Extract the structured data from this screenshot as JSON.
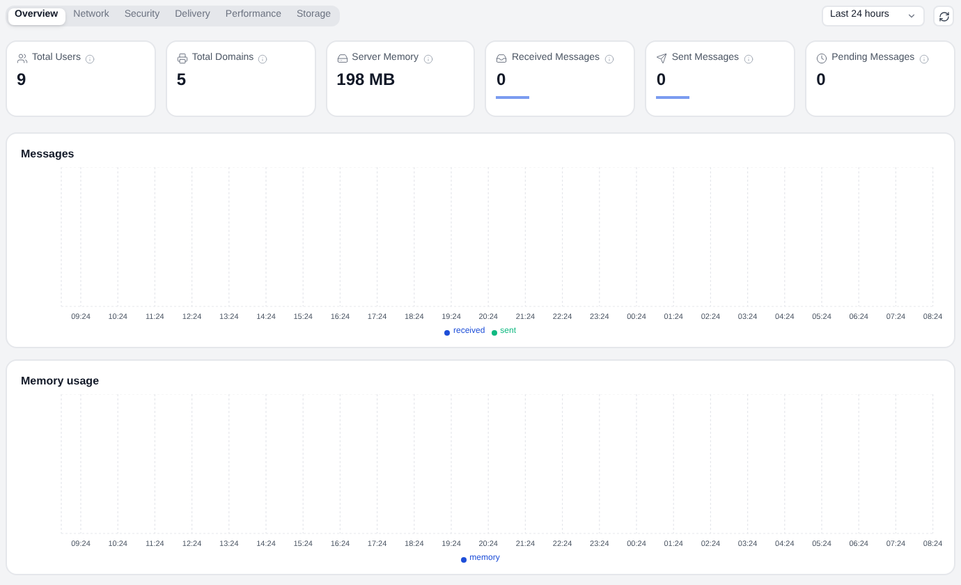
{
  "tabs": [
    {
      "label": "Overview",
      "selected": true
    },
    {
      "label": "Network",
      "selected": false
    },
    {
      "label": "Security",
      "selected": false
    },
    {
      "label": "Delivery",
      "selected": false
    },
    {
      "label": "Performance",
      "selected": false
    },
    {
      "label": "Storage",
      "selected": false
    }
  ],
  "range_select": {
    "value": "Last 24 hours"
  },
  "stats": [
    {
      "kind": "users",
      "label": "Total Users",
      "value": "9",
      "sparkline": false
    },
    {
      "kind": "domains",
      "label": "Total Domains",
      "value": "5",
      "sparkline": false
    },
    {
      "kind": "memory",
      "label": "Server Memory",
      "value": "198 MB",
      "sparkline": false
    },
    {
      "kind": "received",
      "label": "Received Messages",
      "value": "0",
      "sparkline": true
    },
    {
      "kind": "sent",
      "label": "Sent Messages",
      "value": "0",
      "sparkline": true
    },
    {
      "kind": "pending",
      "label": "Pending Messages",
      "value": "0",
      "sparkline": false
    }
  ],
  "panels": [
    {
      "title": "Messages",
      "x_labels": [
        "09:24",
        "10:24",
        "11:24",
        "12:24",
        "13:24",
        "14:24",
        "15:24",
        "16:24",
        "17:24",
        "18:24",
        "19:24",
        "20:24",
        "21:24",
        "22:24",
        "23:24",
        "00:24",
        "01:24",
        "02:24",
        "03:24",
        "04:24",
        "05:24",
        "06:24",
        "07:24",
        "08:24"
      ],
      "legend": [
        {
          "label": "received",
          "color": "#1d4ed8"
        },
        {
          "label": "sent",
          "color": "#10b981"
        }
      ]
    },
    {
      "title": "Memory usage",
      "x_labels": [
        "09:24",
        "10:24",
        "11:24",
        "12:24",
        "13:24",
        "14:24",
        "15:24",
        "16:24",
        "17:24",
        "18:24",
        "19:24",
        "20:24",
        "21:24",
        "22:24",
        "23:24",
        "00:24",
        "01:24",
        "02:24",
        "03:24",
        "04:24",
        "05:24",
        "06:24",
        "07:24",
        "08:24"
      ],
      "legend": [
        {
          "label": "memory",
          "color": "#1d4ed8"
        }
      ]
    }
  ]
}
